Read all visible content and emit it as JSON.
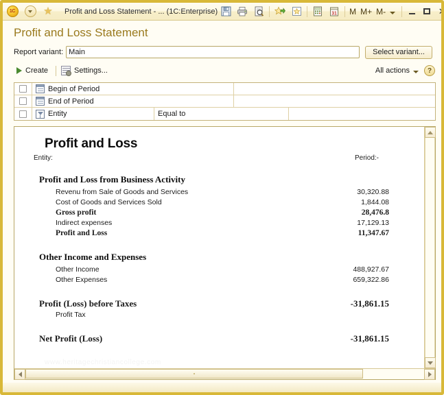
{
  "titlebar": {
    "logo_label": "1C",
    "title": "Profit and Loss Statement - ...  (1C:Enterprise)",
    "icons": {
      "app_logo": "1c-logo-icon",
      "dropdown": "menu-dropdown-icon",
      "favorites_star": "favorites-star-icon",
      "save": "save-icon",
      "print": "print-icon",
      "print_preview": "print-preview-icon",
      "add_favorite": "add-to-favorites-icon",
      "favorite_link": "favorite-link-icon",
      "calculator": "calculator-icon",
      "calendar": "calendar-icon"
    },
    "m_buttons": [
      "M",
      "M+",
      "M-"
    ],
    "window_controls": {
      "minimize": "_",
      "maximize": "□",
      "close": "✕"
    }
  },
  "header": {
    "page_title": "Profit and Loss Statement",
    "variant_label": "Report variant:",
    "variant_value": "Main",
    "variant_placeholder": "Main",
    "select_variant_button": "Select variant..."
  },
  "commandbar": {
    "create_label": "Create",
    "settings_label": "Settings...",
    "all_actions_label": "All actions",
    "help_label": "?"
  },
  "filters": {
    "rows": [
      {
        "name": "Begin of Period",
        "icon": "calendar-icon",
        "comparison": "",
        "value": "",
        "checked": false
      },
      {
        "name": "End of Period",
        "icon": "calendar-icon",
        "comparison": "",
        "value": "",
        "checked": false
      },
      {
        "name": "Entity",
        "icon": "filter-icon",
        "comparison": "Equal to",
        "value": "",
        "checked": false
      }
    ]
  },
  "report": {
    "title": "Profit and Loss",
    "entity_label": "Entity:",
    "period_label": "Period:-",
    "watermark": "www.heritagechristiancollege.com",
    "sections": [
      {
        "heading": "Profit and Loss from Business Activity",
        "lines": [
          {
            "label": "Revenu from Sale of Goods and Services",
            "value": "30,320.88",
            "bold": false
          },
          {
            "label": "Cost of Goods and Services Sold",
            "value": "1,844.08",
            "bold": false
          },
          {
            "label": "Gross profit",
            "value": "28,476.8",
            "bold": true
          },
          {
            "label": "Indirect expenses",
            "value": "17,129.13",
            "bold": false
          },
          {
            "label": "Profit and Loss",
            "value": "11,347.67",
            "bold": true
          }
        ]
      },
      {
        "heading": "Other Income and Expenses",
        "lines": [
          {
            "label": "Other Income",
            "value": "488,927.67",
            "bold": false
          },
          {
            "label": "Other Expenses",
            "value": "659,322.86",
            "bold": false
          }
        ]
      }
    ],
    "totals": [
      {
        "label": "Profit (Loss) before Taxes",
        "value": "-31,861.15"
      },
      {
        "label": "Profit Tax",
        "value": "",
        "sub": true
      },
      {
        "label": "Net Profit (Loss)",
        "value": "-31,861.15"
      }
    ]
  },
  "colors": {
    "window_border": "#d8b838",
    "title_accent": "#9a7a1e",
    "panel_bg": "#fffdf4",
    "grid_border": "#c3b27a"
  }
}
